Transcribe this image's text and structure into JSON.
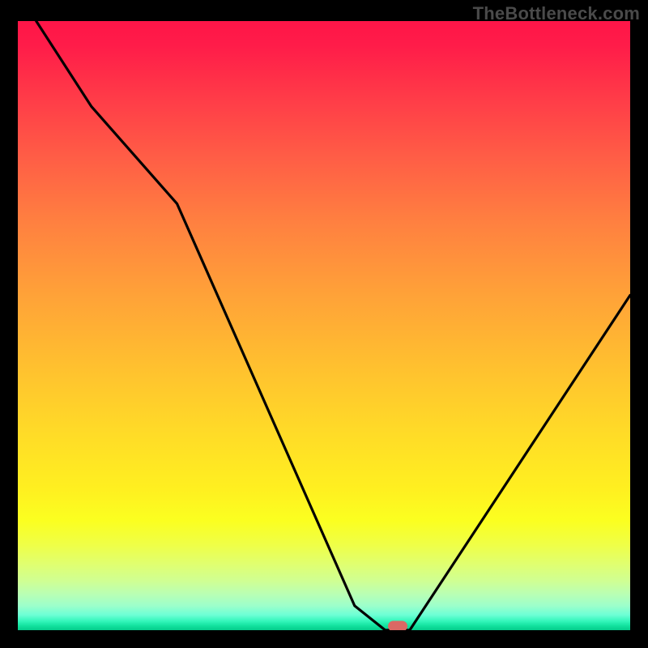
{
  "watermark": "TheBottleneck.com",
  "chart_data": {
    "type": "line",
    "title": "",
    "xlabel": "",
    "ylabel": "",
    "xlim": [
      0,
      100
    ],
    "ylim": [
      0,
      100
    ],
    "series": [
      {
        "name": "bottleneck-curve",
        "x": [
          3,
          12,
          26,
          55,
          60,
          64,
          100
        ],
        "values": [
          100,
          86,
          70,
          4,
          0,
          0,
          55
        ]
      }
    ],
    "annotations": [
      {
        "name": "optimal-point",
        "x": 62,
        "y": 0.7
      }
    ],
    "background": "red-yellow-green vertical gradient",
    "grid": false,
    "legend": false
  },
  "marker": {
    "color": "#db6864"
  }
}
